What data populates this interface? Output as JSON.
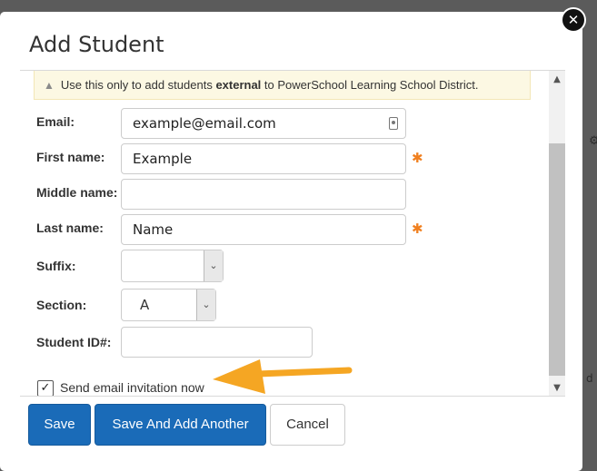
{
  "dialog": {
    "title": "Add Student",
    "close_glyph": "✕",
    "close_icon": "close-icon"
  },
  "background": {
    "gear_glyph": "⚙",
    "partial_text": "d"
  },
  "alert": {
    "icon": "warning-icon",
    "text_before": "Use this only to add students ",
    "text_bold": "external",
    "text_after": " to PowerSchool Learning School District."
  },
  "form": {
    "email": {
      "label": "Email:",
      "value": "example@email.com",
      "icon": "contact-card-icon"
    },
    "first_name": {
      "label": "First name:",
      "value": "Example",
      "required_marker": "✱"
    },
    "middle_name": {
      "label": "Middle name:",
      "value": ""
    },
    "last_name": {
      "label": "Last name:",
      "value": "Name",
      "required_marker": "✱"
    },
    "suffix": {
      "label": "Suffix:",
      "value": ""
    },
    "section": {
      "label": "Section:",
      "value": "A"
    },
    "student_id": {
      "label": "Student ID#:",
      "value": ""
    },
    "send_invite": {
      "label": "Send email invitation now",
      "checked": true,
      "check_glyph": "✓"
    }
  },
  "scrollbar": {
    "up_glyph": "▲",
    "down_glyph": "▼"
  },
  "select_arrow": "⌄",
  "buttons": {
    "save": "Save",
    "save_and_add": "Save And Add Another",
    "cancel": "Cancel"
  },
  "colors": {
    "primary": "#1a6bb8",
    "required": "#f08020",
    "arrow": "#f5a623",
    "alert_bg": "#fcf8e3"
  }
}
